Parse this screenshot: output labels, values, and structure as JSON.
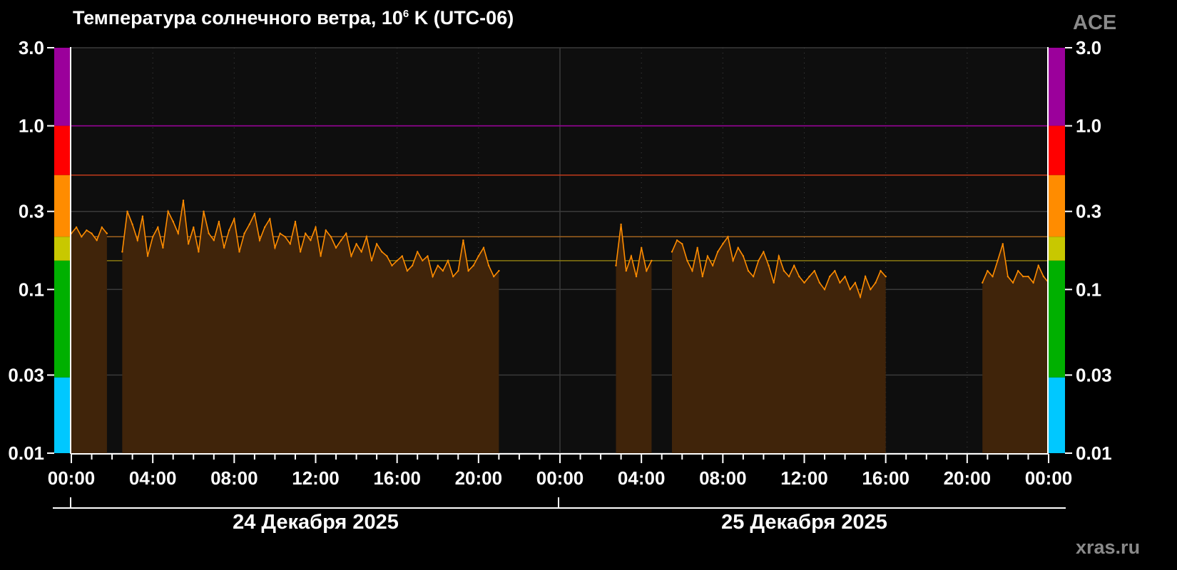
{
  "header": {
    "title_prefix": "Температура солнечного ветра, 10",
    "title_exp": "6",
    "title_suffix": " K (UTC-06)",
    "source": "ACE"
  },
  "footer": {
    "site": "xras.ru"
  },
  "colors": {
    "background": "#000000",
    "plot_background": "#0e0e0e",
    "series_line": "#ff8c00",
    "series_fill": "#40240a",
    "grid": "#3a3a3a",
    "axis": "#ffffff",
    "threshold_purple": "#9b009b",
    "threshold_red": "#c0391b",
    "threshold_orange": "#a0621e",
    "threshold_yellow": "#8a7a10"
  },
  "chart_data": {
    "type": "area",
    "title": "Температура солнечного ветра, 10^6 K (UTC-06)",
    "ylabel": "",
    "yscale": "log",
    "ylim": [
      0.01,
      3.0
    ],
    "y_ticks": [
      "3.0",
      "1.0",
      "0.3",
      "0.1",
      "0.03",
      "0.01"
    ],
    "y_tick_values": [
      3.0,
      1.0,
      0.3,
      0.1,
      0.03,
      0.01
    ],
    "xlim_hours": [
      0,
      48
    ],
    "x_ticks": [
      "00:00",
      "04:00",
      "08:00",
      "12:00",
      "16:00",
      "20:00",
      "00:00",
      "04:00",
      "08:00",
      "12:00",
      "16:00",
      "20:00",
      "00:00"
    ],
    "x_tick_hours": [
      0,
      4,
      8,
      12,
      16,
      20,
      24,
      28,
      32,
      36,
      40,
      44,
      48
    ],
    "days": [
      {
        "label": "24 Декабря 2025",
        "start_hour": 0
      },
      {
        "label": "25 Декабря 2025",
        "start_hour": 24
      }
    ],
    "activity_bands": [
      {
        "from": 1.0,
        "to": 3.0,
        "color": "#9b009b"
      },
      {
        "from": 0.5,
        "to": 1.0,
        "color": "#ff0000"
      },
      {
        "from": 0.21,
        "to": 0.5,
        "color": "#ff8c00"
      },
      {
        "from": 0.15,
        "to": 0.21,
        "color": "#c8c800"
      },
      {
        "from": 0.029,
        "to": 0.15,
        "color": "#00b000"
      },
      {
        "from": 0.01,
        "to": 0.029,
        "color": "#00c8ff"
      }
    ],
    "threshold_lines": [
      {
        "value": 1.0,
        "color": "#9b009b"
      },
      {
        "value": 0.5,
        "color": "#c0391b"
      },
      {
        "value": 0.21,
        "color": "#a0621e"
      },
      {
        "value": 0.15,
        "color": "#8a7a10"
      }
    ],
    "series": [
      {
        "name": "ACE",
        "x_hours": [
          0.0,
          0.25,
          0.5,
          0.75,
          1.0,
          1.25,
          1.5,
          1.75,
          2.5,
          2.75,
          3.0,
          3.25,
          3.5,
          3.75,
          4.0,
          4.25,
          4.5,
          4.75,
          5.0,
          5.25,
          5.5,
          5.75,
          6.0,
          6.25,
          6.5,
          6.75,
          7.0,
          7.25,
          7.5,
          7.75,
          8.0,
          8.25,
          8.5,
          8.75,
          9.0,
          9.25,
          9.5,
          9.75,
          10.0,
          10.25,
          10.5,
          10.75,
          11.0,
          11.25,
          11.5,
          11.75,
          12.0,
          12.25,
          12.5,
          12.75,
          13.0,
          13.25,
          13.5,
          13.75,
          14.0,
          14.25,
          14.5,
          14.75,
          15.0,
          15.25,
          15.5,
          15.75,
          16.0,
          16.25,
          16.5,
          16.75,
          17.0,
          17.25,
          17.5,
          17.75,
          18.0,
          18.25,
          18.5,
          18.75,
          19.0,
          19.25,
          19.5,
          19.75,
          20.0,
          20.25,
          20.5,
          20.75,
          21.0,
          26.75,
          27.0,
          27.25,
          27.5,
          27.75,
          28.0,
          28.25,
          28.5,
          29.5,
          29.75,
          30.0,
          30.25,
          30.5,
          30.75,
          31.0,
          31.25,
          31.5,
          31.75,
          32.0,
          32.25,
          32.5,
          32.75,
          33.0,
          33.25,
          33.5,
          33.75,
          34.0,
          34.25,
          34.5,
          34.75,
          35.0,
          35.25,
          35.5,
          35.75,
          36.0,
          36.25,
          36.5,
          36.75,
          37.0,
          37.25,
          37.5,
          37.75,
          38.0,
          38.25,
          38.5,
          38.75,
          39.0,
          39.25,
          39.5,
          39.75,
          40.0,
          44.75,
          45.0,
          45.25,
          45.5,
          45.75,
          46.0,
          46.25,
          46.5,
          46.75,
          47.0,
          47.25,
          47.5,
          47.75,
          48.0
        ],
        "values": [
          0.22,
          0.24,
          0.21,
          0.23,
          0.22,
          0.2,
          0.24,
          0.22,
          0.17,
          0.3,
          0.25,
          0.2,
          0.28,
          0.16,
          0.21,
          0.24,
          0.18,
          0.3,
          0.26,
          0.22,
          0.35,
          0.19,
          0.24,
          0.17,
          0.3,
          0.22,
          0.2,
          0.26,
          0.18,
          0.23,
          0.27,
          0.17,
          0.22,
          0.25,
          0.29,
          0.2,
          0.24,
          0.27,
          0.18,
          0.22,
          0.21,
          0.19,
          0.26,
          0.17,
          0.22,
          0.2,
          0.24,
          0.16,
          0.23,
          0.21,
          0.18,
          0.2,
          0.22,
          0.16,
          0.19,
          0.17,
          0.21,
          0.15,
          0.19,
          0.17,
          0.16,
          0.14,
          0.15,
          0.16,
          0.13,
          0.14,
          0.17,
          0.15,
          0.16,
          0.12,
          0.14,
          0.13,
          0.15,
          0.12,
          0.13,
          0.2,
          0.13,
          0.14,
          0.16,
          0.18,
          0.14,
          0.12,
          0.13,
          0.14,
          0.25,
          0.13,
          0.16,
          0.12,
          0.18,
          0.13,
          0.15,
          0.17,
          0.2,
          0.19,
          0.15,
          0.13,
          0.18,
          0.12,
          0.16,
          0.14,
          0.17,
          0.19,
          0.21,
          0.15,
          0.18,
          0.16,
          0.13,
          0.12,
          0.15,
          0.17,
          0.14,
          0.11,
          0.16,
          0.13,
          0.12,
          0.14,
          0.12,
          0.11,
          0.12,
          0.13,
          0.11,
          0.1,
          0.12,
          0.13,
          0.11,
          0.12,
          0.1,
          0.11,
          0.09,
          0.12,
          0.1,
          0.11,
          0.13,
          0.12,
          0.11,
          0.13,
          0.12,
          0.15,
          0.19,
          0.12,
          0.11,
          0.13,
          0.12,
          0.12,
          0.11,
          0.14,
          0.12,
          0.11,
          0.14,
          0.15,
          0.16
        ]
      }
    ],
    "grid": true,
    "legend": "none"
  }
}
